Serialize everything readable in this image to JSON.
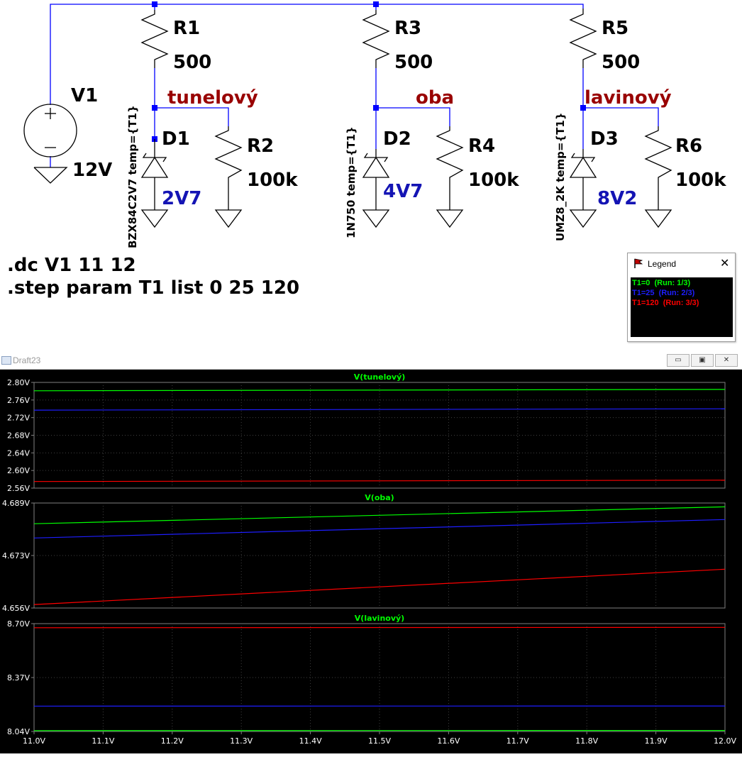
{
  "schematic": {
    "directives": [
      ".dc V1 11 12",
      ".step param T1 list 0 25 120"
    ],
    "source": {
      "name": "V1",
      "value": "12V"
    },
    "resistors": [
      {
        "name": "R1",
        "value": "500"
      },
      {
        "name": "R2",
        "value": "100k"
      },
      {
        "name": "R3",
        "value": "500"
      },
      {
        "name": "R4",
        "value": "100k"
      },
      {
        "name": "R5",
        "value": "500"
      },
      {
        "name": "R6",
        "value": "100k"
      }
    ],
    "diodes": [
      {
        "name": "D1",
        "model": "BZX84C2V7 temp={T1}",
        "voltage": "2V7"
      },
      {
        "name": "D2",
        "model": "1N750 temp={T1}",
        "voltage": "4V7"
      },
      {
        "name": "D3",
        "model": "UMZ8_2K temp={T1}",
        "voltage": "8V2"
      }
    ],
    "net_labels": [
      "tunelový",
      "oba",
      "lavinový"
    ],
    "colors": {
      "wire": "#0000ff",
      "component": "#000000",
      "net_label": "#990000",
      "diode_voltage": "#1414b4",
      "junction": "#0000ff"
    }
  },
  "legend": {
    "title": "Legend",
    "close": "✕",
    "entries": [
      {
        "text": "T1=0  (Run: 1/3)",
        "color": "#00ff00"
      },
      {
        "text": "T1=25  (Run: 2/3)",
        "color": "#1e1eff"
      },
      {
        "text": "T1=120  (Run: 3/3)",
        "color": "#ff0000"
      }
    ]
  },
  "window": {
    "title": "Draft23",
    "buttons": [
      "▭",
      "▣",
      "✕"
    ]
  },
  "chart_data": [
    {
      "type": "line",
      "title": "V(tunelový)",
      "x": [
        11.0,
        12.0
      ],
      "ylim": [
        2.56,
        2.8
      ],
      "yticks": [
        "2.80V",
        "2.76V",
        "2.72V",
        "2.68V",
        "2.64V",
        "2.60V",
        "2.56V"
      ],
      "series": [
        {
          "name": "T1=0",
          "color": "#00ff00",
          "values": [
            2.781,
            2.784
          ]
        },
        {
          "name": "T1=25",
          "color": "#1e1eff",
          "values": [
            2.737,
            2.74
          ]
        },
        {
          "name": "T1=120",
          "color": "#ff0000",
          "values": [
            2.575,
            2.578
          ]
        }
      ]
    },
    {
      "type": "line",
      "title": "V(oba)",
      "x": [
        11.0,
        12.0
      ],
      "ylim": [
        4.656,
        4.689
      ],
      "yticks": [
        "4.689V",
        "4.673V",
        "4.656V"
      ],
      "series": [
        {
          "name": "T1=0",
          "color": "#00ff00",
          "values": [
            4.6825,
            4.6878
          ]
        },
        {
          "name": "T1=25",
          "color": "#1e1eff",
          "values": [
            4.678,
            4.6838
          ]
        },
        {
          "name": "T1=120",
          "color": "#ff0000",
          "values": [
            4.6571,
            4.6682
          ]
        }
      ]
    },
    {
      "type": "line",
      "title": "V(lavinový)",
      "x": [
        11.0,
        12.0
      ],
      "ylim": [
        8.04,
        8.7
      ],
      "yticks": [
        "8.70V",
        "8.37V",
        "8.04V"
      ],
      "xticks": [
        "11.0V",
        "11.1V",
        "11.2V",
        "11.3V",
        "11.4V",
        "11.5V",
        "11.6V",
        "11.7V",
        "11.8V",
        "11.9V",
        "12.0V"
      ],
      "series": [
        {
          "name": "T1=0",
          "color": "#00ff00",
          "values": [
            8.045,
            8.046
          ]
        },
        {
          "name": "T1=25",
          "color": "#1e1eff",
          "values": [
            8.195,
            8.196
          ]
        },
        {
          "name": "T1=120",
          "color": "#ff0000",
          "values": [
            8.675,
            8.677
          ]
        }
      ]
    }
  ]
}
